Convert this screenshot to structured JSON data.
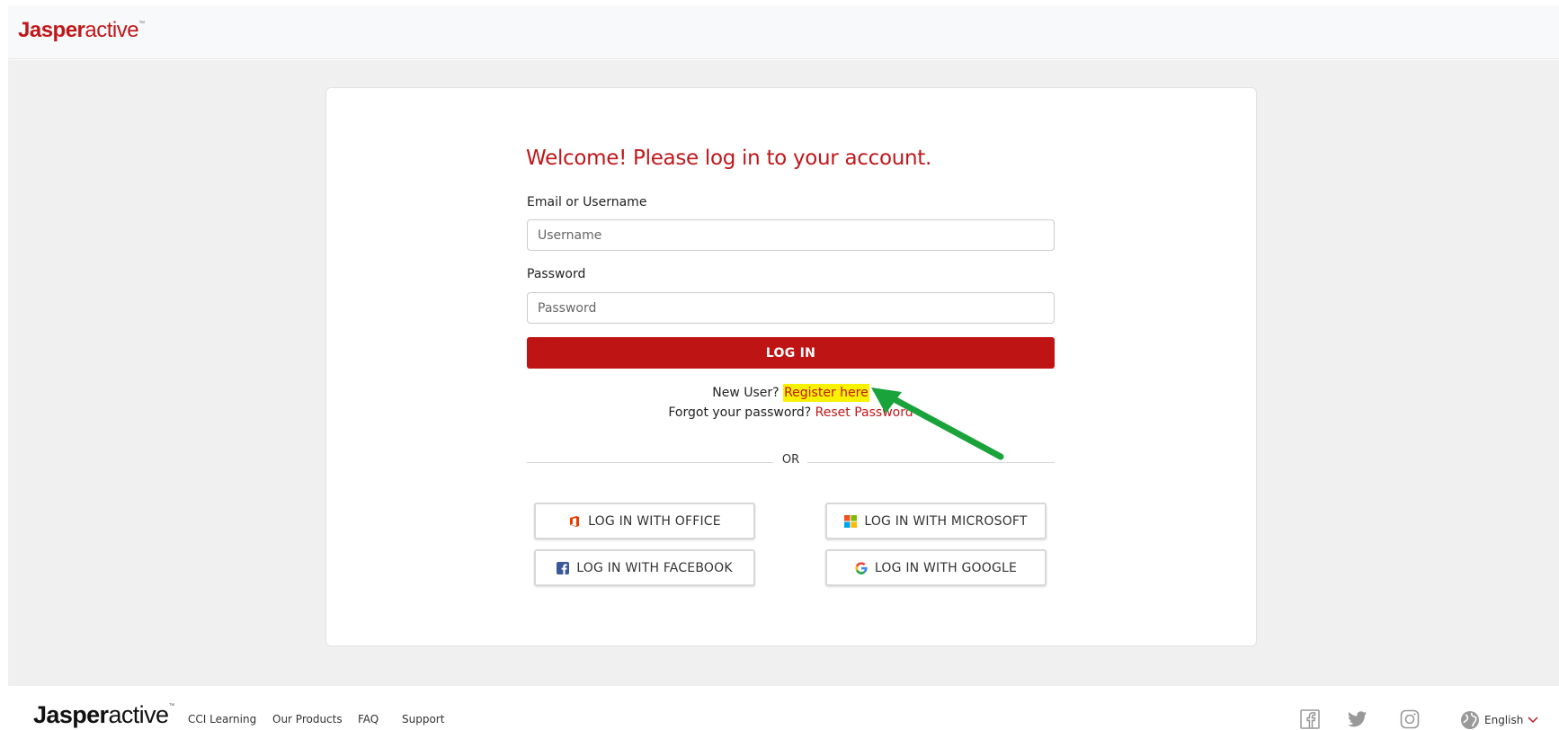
{
  "header": {
    "logo_bold": "Jasper",
    "logo_rest": "active",
    "logo_tm": "™"
  },
  "form": {
    "title": "Welcome! Please log in to your account.",
    "email_label": "Email or Username",
    "email_placeholder": "Username",
    "password_label": "Password",
    "password_placeholder": "Password",
    "login_button": "LOG IN",
    "new_user_text": "New User?",
    "register_link": "Register here",
    "forgot_text": "Forgot your password?",
    "reset_link": "Reset Password",
    "or_text": "OR"
  },
  "social": {
    "office": "LOG IN WITH OFFICE",
    "microsoft": "LOG IN WITH MICROSOFT",
    "facebook": "LOG IN WITH FACEBOOK",
    "google": "LOG IN WITH GOOGLE"
  },
  "footer": {
    "logo_bold": "Jasper",
    "logo_rest": "active",
    "logo_tm": "™",
    "links": [
      "CCI Learning",
      "Our Products",
      "FAQ",
      "Support"
    ],
    "language": "English"
  },
  "colors": {
    "brand_red": "#c0171b",
    "highlight": "#f8f100",
    "arrow_green": "#1aa33b"
  },
  "icons": [
    "office-icon",
    "microsoft-icon",
    "facebook-icon",
    "google-icon",
    "facebook-social-icon",
    "twitter-icon",
    "instagram-icon",
    "globe-icon",
    "chevron-down-icon",
    "annotation-arrow"
  ]
}
